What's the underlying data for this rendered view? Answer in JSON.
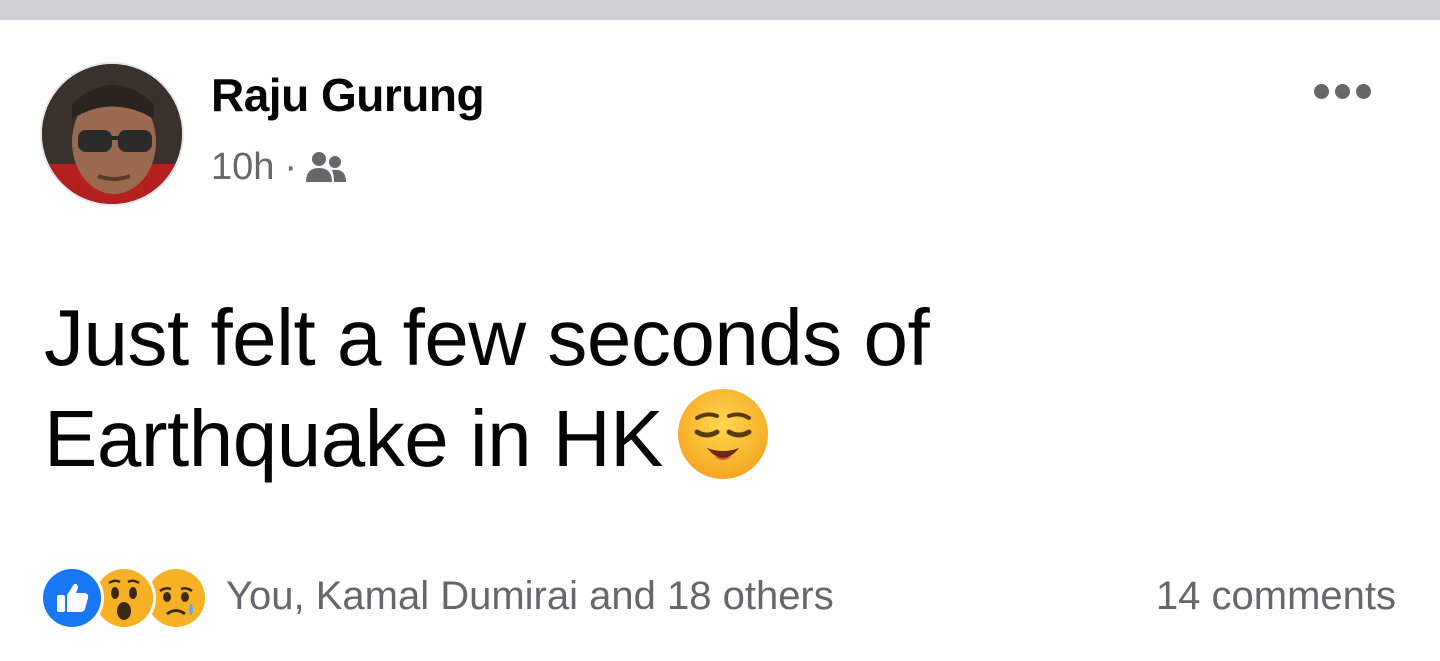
{
  "post": {
    "author": "Raju Gurung",
    "time": "10h",
    "separator": "·",
    "audience_icon": "friends-icon",
    "text_line1": "Just felt a few seconds of",
    "text_line2": "Earthquake in HK",
    "emoji": "relieved-face-emoji",
    "more_icon": "more-options-icon"
  },
  "footer": {
    "reactions": [
      "like-reaction-icon",
      "wow-reaction-icon",
      "sad-reaction-icon"
    ],
    "reactors_text": "You, Kamal Dumirai and 18 others",
    "comments_text": "14 comments"
  },
  "colors": {
    "top_bar": "#ced0d4",
    "secondary_text": "#65676b",
    "like_blue": "#1877f2",
    "emoji_yellow": "#f7b125"
  }
}
